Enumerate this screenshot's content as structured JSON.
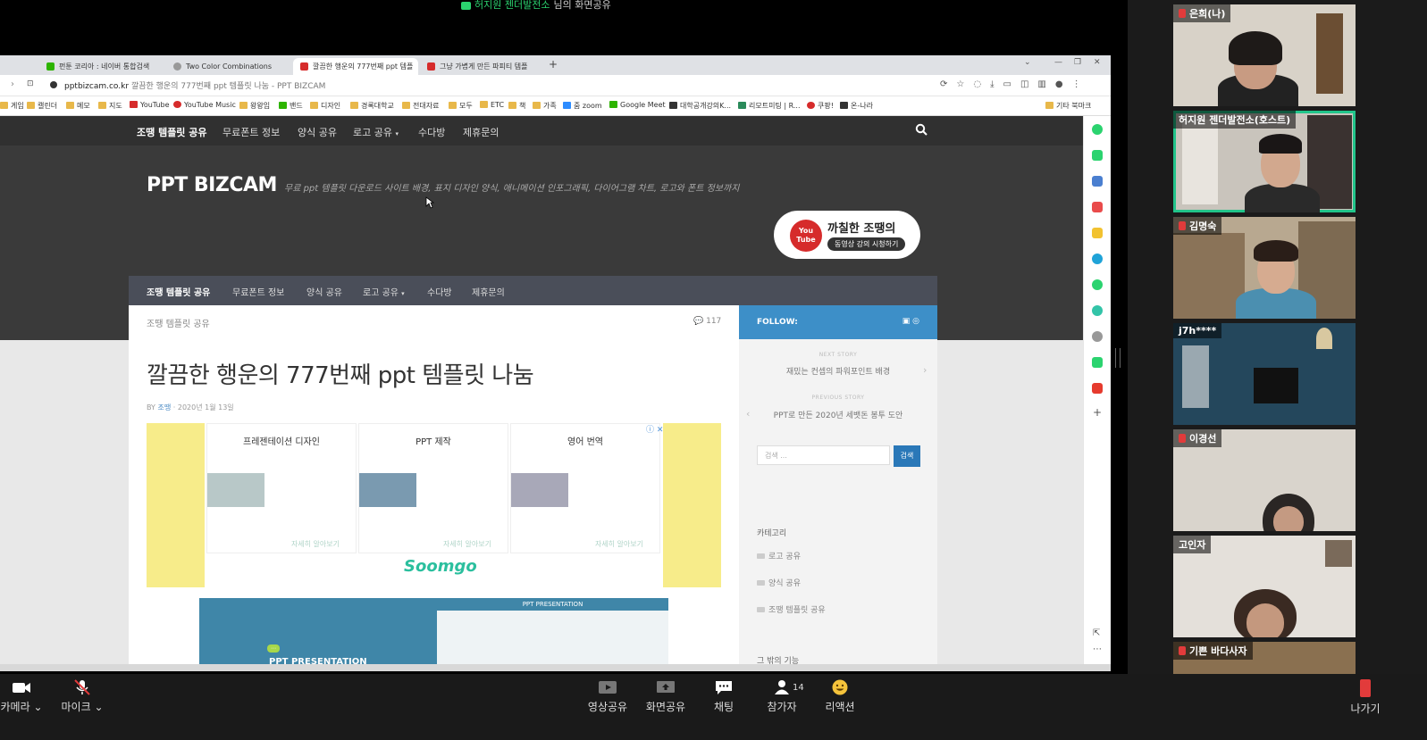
{
  "share_banner": {
    "sharer": "허지원 젠더발전소",
    "suffix": "님의 화면공유"
  },
  "browser": {
    "tabs": [
      {
        "label": "펀툰 코리아 : 네이버 통합검색",
        "active": false
      },
      {
        "label": "Two Color Combinations",
        "active": false
      },
      {
        "label": "깔끔한 행운의 777번째 ppt 템플",
        "active": true
      },
      {
        "label": "그냥 가볍게 만든 파피티 템플",
        "active": false
      }
    ],
    "url_host": "pptbizcam.co.kr",
    "url_title": "깔끔한 행운의 777번째 ppt 템플릿 나눔 - PPT BIZCAM",
    "bookmarks": [
      "게임",
      "캘린더",
      "메모",
      "지도",
      "YouTube",
      "YouTube Music",
      "왕왕임",
      "밴드",
      "디자인",
      "경록대학교",
      "전대자료",
      "모두",
      "ETC",
      "책",
      "가족",
      "줌 zoom",
      "Google Meet",
      "대학공개강의K...",
      "리모트미팅 | R...",
      "쿠팡!",
      "온-나라"
    ],
    "bookmarks_other": "기타 북마크"
  },
  "site": {
    "nav": [
      "조땡 템플릿 공유",
      "무료폰트 정보",
      "양식 공유",
      "로고 공유",
      "수다방",
      "제휴문의"
    ],
    "title": "PPT BIZCAM",
    "description": "무료 ppt 템플릿 다운로드 사이트 배경, 표지 디자인 양식, 애니메이션 인포그래픽, 다이어그램 차트, 로고와 폰트 정보까지",
    "youtube_badge": {
      "logo": "You Tube",
      "title": "까칠한 조땡의",
      "subtitle": "동영상 강의 시청하기"
    },
    "subnav": [
      "조땡 템플릿 공유",
      "무료폰트 정보",
      "양식 공유",
      "로고 공유",
      "수다방",
      "제휴문의"
    ],
    "breadcrumb": "조땡 템플릿 공유",
    "comment_count": "117",
    "post_title": "깔끔한 행운의 777번째 ppt 템플릿 나눔",
    "post_meta_by": "BY",
    "post_meta_author": "조땡",
    "post_meta_date": "· 2020년 1월 13일",
    "ad": {
      "cards": [
        {
          "label": "프레젠테이션 디자인",
          "more": "자세히 알아보기"
        },
        {
          "label": "PPT 제작",
          "more": "자세히 알아보기"
        },
        {
          "label": "영어 번역",
          "more": "자세히 알아보기"
        }
      ],
      "brand": "Soomgo",
      "choice": "ⓘ ✕"
    },
    "ppt_preview": {
      "header": "PPT PRESENTATION",
      "title": "PPT PRESENTATION"
    },
    "sidebar": {
      "follow": "FOLLOW:",
      "next_label": "NEXT STORY",
      "next_story": "재밌는 컨셉의 파워포인트 배경",
      "prev_label": "PREVIOUS STORY",
      "prev_story": "PPT로 만든 2020년 세뱃돈 봉투 도안",
      "search_placeholder": "검색 ...",
      "search_button": "검색",
      "category_head": "카테고리",
      "categories": [
        "로고 공유",
        "양식 공유",
        "조땡 템플릿 공유"
      ],
      "extra_head": "그 밖의 기능"
    }
  },
  "gallery": [
    {
      "name": "은희(나)",
      "muted": true,
      "host": false
    },
    {
      "name": "허지원 젠더발전소(호스트)",
      "muted": false,
      "host": true
    },
    {
      "name": "김명숙",
      "muted": true,
      "host": false
    },
    {
      "name": "j7h****",
      "muted": false,
      "host": false
    },
    {
      "name": "이경선",
      "muted": true,
      "host": false
    },
    {
      "name": "고인자",
      "muted": false,
      "host": false
    },
    {
      "name": "기쁜 바다사자",
      "muted": true,
      "host": false
    }
  ],
  "toolbar": {
    "camera": "카메라",
    "mic": "마이크",
    "video_share": "영상공유",
    "screen_share": "화면공유",
    "chat": "채팅",
    "participants": "참가자",
    "participant_count": "14",
    "reaction": "리액션",
    "leave": "나가기"
  },
  "colors": {
    "host_border": "#22c48a",
    "accent_blue": "#3d8fc8",
    "muted_red": "#e23b3b"
  }
}
